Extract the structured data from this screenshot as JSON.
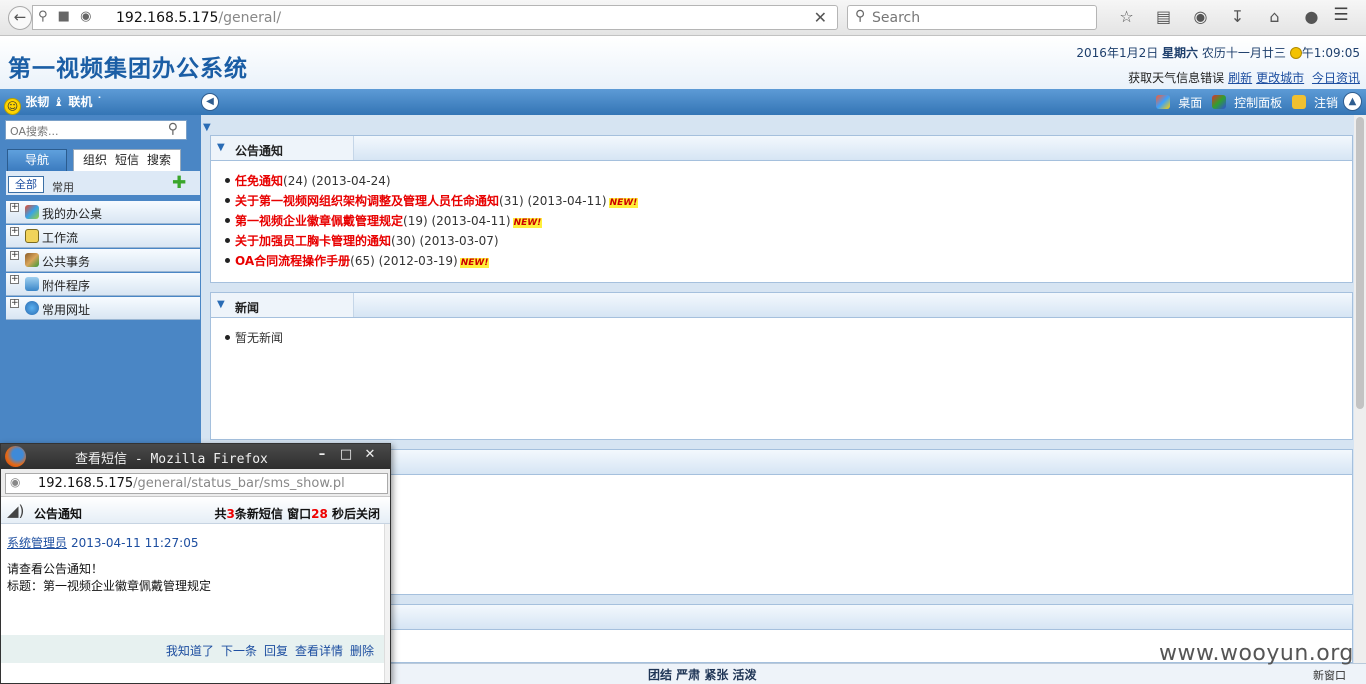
{
  "browser": {
    "url_host": "192.168.5.175",
    "url_path": "/general/",
    "search_placeholder": "Search"
  },
  "header": {
    "title": "第一视频集团办公系统",
    "date": "2016年1月2日",
    "weekday": "星期六",
    "lunar": "农历十一月廿三",
    "time": "午1:09:05",
    "weather_error": "获取天气信息错误",
    "links": [
      "刷新",
      "更改城市",
      "今日资讯"
    ]
  },
  "statusbar": {
    "user": "张韧",
    "status": "联机",
    "tools": [
      "桌面",
      "控制面板",
      "注销"
    ]
  },
  "sidebar": {
    "search_placeholder": "OA搜索...",
    "tabs": [
      "导航",
      "组织",
      "短信",
      "搜索"
    ],
    "subtabs": [
      "全部",
      "常用"
    ],
    "items": [
      {
        "label": "我的办公桌"
      },
      {
        "label": "工作流"
      },
      {
        "label": "公共事务"
      },
      {
        "label": "附件程序"
      },
      {
        "label": "常用网址"
      }
    ]
  },
  "panels": {
    "notice": {
      "title": "公告通知",
      "items": [
        {
          "title": "任免通知",
          "meta": "(24) (2013-04-24)",
          "new": ""
        },
        {
          "title": "关于第一视频网组织架构调整及管理人员任命通知",
          "meta": "(31) (2013-04-11)",
          "new": "NEW!"
        },
        {
          "title": "第一视频企业徽章佩戴管理规定",
          "meta": "(19) (2013-04-11)",
          "new": "NEW!"
        },
        {
          "title": "关于加强员工胸卡管理的通知",
          "meta": "(30) (2013-03-07)",
          "new": ""
        },
        {
          "title": "OA合同流程操作手册",
          "meta": "(65) (2012-03-19)",
          "new": "NEW!"
        }
      ]
    },
    "news": {
      "title": "新闻",
      "empty": "暂无新闻"
    }
  },
  "footer": {
    "motto": "团结 严肃 紧张 活泼",
    "new_window": "新窗口",
    "watermark": "www.wooyun.org"
  },
  "popup": {
    "window_title": "查看短信 - Mozilla Firefox",
    "url_host": "192.168.5.175",
    "url_path": "/general/status_bar/sms_show.pl",
    "kind": "公告通知",
    "count_prefix": "共",
    "count": "3",
    "count_mid": "条新短信 窗口",
    "seconds": "28",
    "count_suffix": "秒后关闭",
    "sender": "系统管理员",
    "timestamp": "2013-04-11 11:27:05",
    "body_line1": "请查看公告通知！",
    "body_line2": "标题：第一视频企业徽章佩戴管理规定",
    "actions": [
      "我知道了",
      "下一条",
      "回复",
      "查看详情",
      "删除"
    ]
  }
}
